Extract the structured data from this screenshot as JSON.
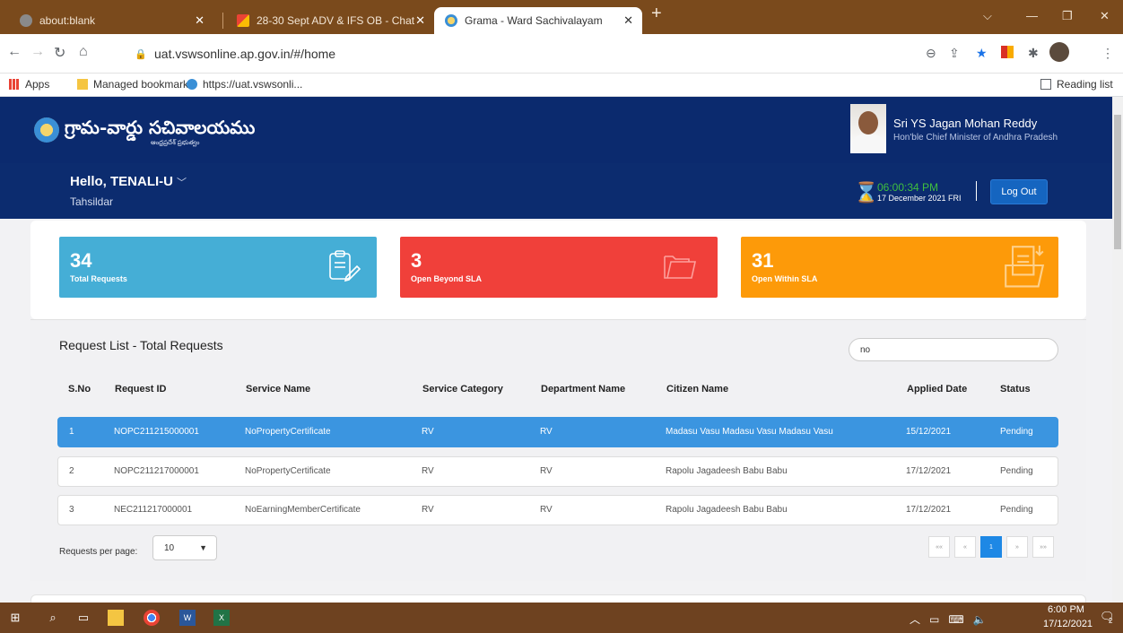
{
  "browser": {
    "tabs": [
      {
        "title": "about:blank",
        "icon": "globe-icon"
      },
      {
        "title": "28-30 Sept ADV & IFS OB - Chat",
        "icon": "gmail-icon"
      },
      {
        "title": "Grama - Ward Sachivalayam",
        "icon": "site-icon"
      }
    ],
    "new_tab": "+",
    "url": "uat.vswsonline.ap.gov.in/#/home",
    "bookmarks": [
      "Apps",
      "Managed bookmarks",
      "https://uat.vswsonli..."
    ],
    "reading_list": "Reading list"
  },
  "header": {
    "logo_text": "గ్రామ-వార్డు సచివాలయము",
    "logo_sub": "ఆంధ్రప్రదేశ్ ప్రభుత్వం",
    "cm_name": "Sri YS Jagan Mohan Reddy",
    "cm_title": "Hon'ble Chief Minister of Andhra Pradesh"
  },
  "user": {
    "greeting": "Hello, TENALI-U",
    "role": "Tahsildar",
    "time": "06:00:34 PM",
    "date": "17 December 2021 FRI",
    "logout": "Log Out"
  },
  "stats": [
    {
      "value": "34",
      "label": "Total Requests",
      "color": "#45aed6"
    },
    {
      "value": "3",
      "label": "Open Beyond SLA",
      "color": "#f0403a"
    },
    {
      "value": "31",
      "label": "Open Within SLA",
      "color": "#fd9a09"
    }
  ],
  "list": {
    "title": "Request List - Total Requests",
    "search_value": "no",
    "columns": [
      "S.No",
      "Request ID",
      "Service Name",
      "Service Category",
      "Department Name",
      "Citizen Name",
      "Applied Date",
      "Status"
    ],
    "rows": [
      [
        "1",
        "NOPC211215000001",
        "NoPropertyCertificate",
        "RV",
        "RV",
        "Madasu Vasu Madasu Vasu Madasu Vasu",
        "15/12/2021",
        "Pending"
      ],
      [
        "2",
        "NOPC211217000001",
        "NoPropertyCertificate",
        "RV",
        "RV",
        "Rapolu Jagadeesh Babu Babu",
        "17/12/2021",
        "Pending"
      ],
      [
        "3",
        "NEC211217000001",
        "NoEarningMemberCertificate",
        "RV",
        "RV",
        "Rapolu Jagadeesh Babu Babu",
        "17/12/2021",
        "Pending"
      ]
    ],
    "per_page_label": "Requests per page:",
    "per_page_value": "10",
    "pagination": [
      "««",
      "«",
      "1",
      "»",
      "»»"
    ]
  },
  "taskbar": {
    "time": "6:00 PM",
    "date": "17/12/2021",
    "notifications": "2"
  }
}
